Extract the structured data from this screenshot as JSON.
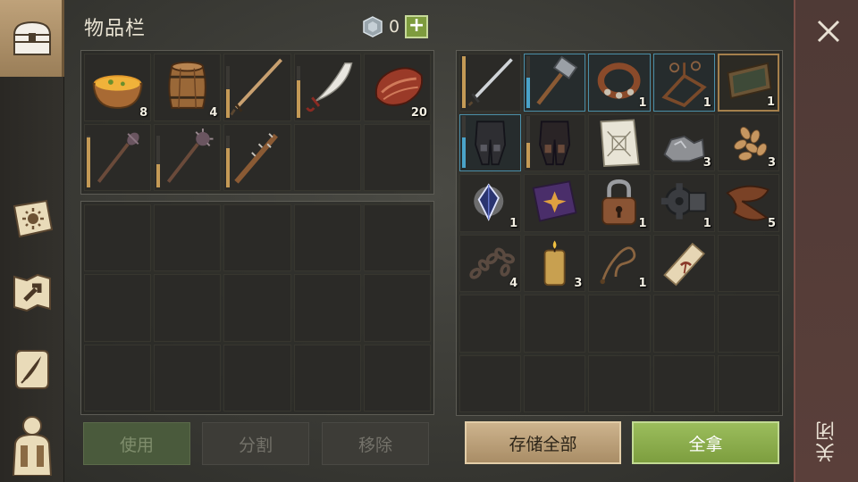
{
  "inventory": {
    "title": "物品栏",
    "currency_value": "0",
    "currency_icon": "gem-coin-icon",
    "add_currency_label": "+",
    "slots": [
      {
        "icon": "pumpkin-soup-bowl-icon",
        "qty": "8"
      },
      {
        "icon": "wooden-barrel-icon",
        "qty": "4"
      },
      {
        "icon": "long-sword-icon",
        "qty": "",
        "durability": 0.55
      },
      {
        "icon": "scimitar-icon",
        "qty": "",
        "durability": 0.7
      },
      {
        "icon": "raw-meat-icon",
        "qty": "20"
      },
      {
        "icon": "spiked-mace-icon",
        "qty": "",
        "durability": 0.95
      },
      {
        "icon": "morning-star-icon",
        "qty": "",
        "durability": 0.45
      },
      {
        "icon": "spiked-club-icon",
        "qty": "",
        "durability": 0.75
      }
    ],
    "buttons": {
      "use": "使用",
      "split": "分割",
      "remove": "移除"
    }
  },
  "container": {
    "slots": [
      {
        "icon": "steel-sword-icon",
        "qty": "",
        "durability": 1.0,
        "frame": "gold-bar"
      },
      {
        "icon": "sledgehammer-icon",
        "qty": "",
        "durability": 0.6,
        "frame": "blue"
      },
      {
        "icon": "spiked-collar-icon",
        "qty": "1",
        "frame": "blue"
      },
      {
        "icon": "trap-frame-icon",
        "qty": "1",
        "frame": "blue"
      },
      {
        "icon": "wooden-tray-icon",
        "qty": "1",
        "frame": "gold"
      },
      {
        "icon": "armored-leggings-icon",
        "qty": "",
        "durability": 0.6,
        "frame": "blue"
      },
      {
        "icon": "leather-leggings-icon",
        "qty": "",
        "durability": 0.5,
        "frame": "gold-bar"
      },
      {
        "icon": "blueprint-scroll-icon",
        "qty": ""
      },
      {
        "icon": "iron-ore-icon",
        "qty": "3"
      },
      {
        "icon": "seeds-icon",
        "qty": "3"
      },
      {
        "icon": "crystal-shard-icon",
        "qty": "1"
      },
      {
        "icon": "spell-book-icon",
        "qty": ""
      },
      {
        "icon": "padlock-icon",
        "qty": "1"
      },
      {
        "icon": "gear-mechanism-icon",
        "qty": "1"
      },
      {
        "icon": "leather-strip-icon",
        "qty": "5"
      },
      {
        "icon": "chain-icon",
        "qty": "4"
      },
      {
        "icon": "candle-icon",
        "qty": "3"
      },
      {
        "icon": "rope-icon",
        "qty": "1"
      },
      {
        "icon": "parchment-roll-icon",
        "qty": ""
      }
    ],
    "buttons": {
      "store_all": "存储全部",
      "take_all": "全拿"
    }
  },
  "sidebar": {
    "items": [
      {
        "icon": "chest-icon",
        "active": true
      },
      {
        "icon": "sun-book-icon"
      },
      {
        "icon": "crafting-map-icon"
      },
      {
        "icon": "quill-scroll-icon"
      },
      {
        "icon": "character-backpack-icon"
      }
    ]
  },
  "close": {
    "label": "关闭",
    "icon": "close-icon"
  }
}
